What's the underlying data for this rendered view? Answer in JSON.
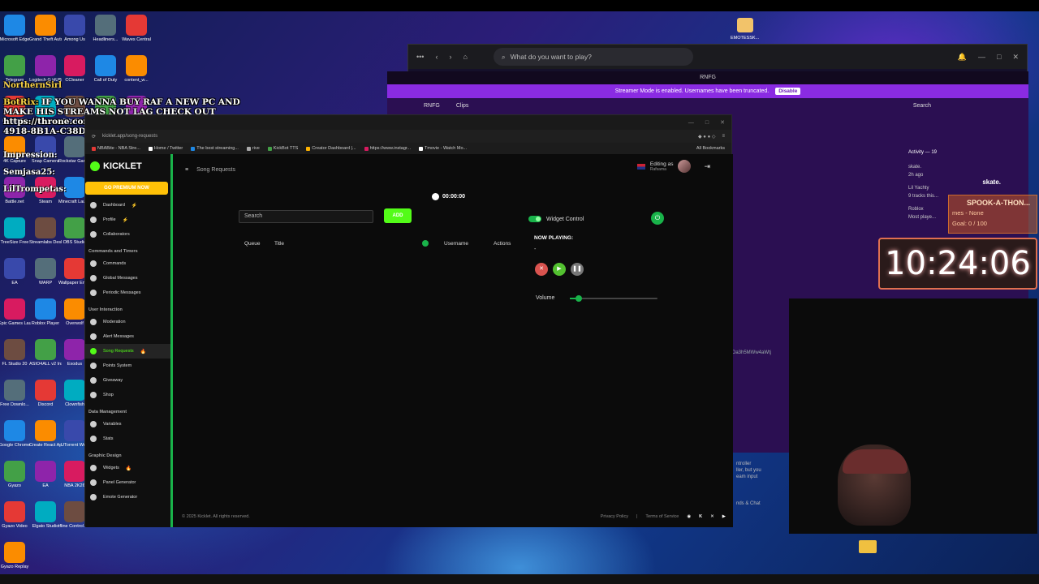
{
  "overlay": {
    "message_user": "BotRix:",
    "message": "IF YOU WANNA BUY RAF A NEW PC AND MAKE HIS STREAMS NOT LAG CHECK OUT https://throne.com/rafsama/item/E0E75993-23DF-4918-8B1A-C38D67313457",
    "northern": "NorthernSirl",
    "impression": "Impression:",
    "semjasa": "Semjasa25:",
    "trompetas": "LilTrompetas:"
  },
  "desktop_icons": {
    "col1": [
      "Microsoft Edge",
      "Telegram",
      "NorthernSirl",
      "4K Capture",
      "Battle.net",
      "TreeSize Free",
      "EA",
      "Epic Games Launcher",
      "FL Studio 20",
      "Free Downlo...",
      "Google Chrome",
      "Gyazo",
      "Gyazo Video",
      "Gyazo Replay"
    ],
    "col2": [
      "Grand Theft Auto V",
      "Logitech G HUB",
      "",
      "Snap Camera",
      "Steam",
      "Streamlabs Desktop",
      "WARP",
      "Roblox Player",
      "ASIO4ALL v2 Instruction...",
      "Discord",
      "Create React App Sample",
      "EA",
      "Elgato Studio"
    ],
    "col3": [
      "Among Us",
      "CCleaner",
      "Baby Steps",
      "Rockstar Games",
      "Minecraft Launcher",
      "OBS Studio",
      "Wallpaper Engine",
      "Overwolf",
      "Exodus",
      "Clownfish",
      "UTorrent Web",
      "NBA 2K26",
      "tfline Control Deck.exe"
    ],
    "col4": [
      "Headliners...",
      "Call of Duty",
      "NVIDIA App",
      "skate.",
      ""
    ],
    "col5": [
      "Waves Central",
      "content_w...",
      "content_w...",
      "content_wa..."
    ],
    "emotes": "EMOTESSK..."
  },
  "bg_browser": {
    "search_placeholder": "What do you want to play?",
    "discord_title": "RNFG",
    "streamer_mode": "Streamer Mode is enabled. Usernames have been truncated.",
    "disable_label": "Disable",
    "server_name": "RNFG",
    "channel_name": "Clips",
    "search_label": "Search",
    "activity_title": "Activity — 19",
    "activity_items": [
      "skate.",
      "2h ago",
      "Lil Yachty",
      "9 tracks this...",
      "Roblox",
      "Most playe..."
    ],
    "skate_label": "skate.",
    "hash_text": "tOa3h5MWw4aWtj",
    "controller_text": "ntroller\nller, but you\neam input",
    "friends_chat": "nds & Chat"
  },
  "browser": {
    "url": "kicklet.app/song-requests",
    "bookmarks": [
      "NBABite - NBA Stre...",
      "Home / Twitter",
      "The best streaming...",
      "rive",
      "KickBot TTS",
      "Creator Dashboard |...",
      "https://www.instagr...",
      "Tmovie - Watch Mo..."
    ],
    "all_bookmarks": "All Bookmarks"
  },
  "app": {
    "logo_text": "KICKLET",
    "premium_label": "GO PREMIUM NOW",
    "page_title": "Song Requests",
    "editing_as": "Editing as",
    "editing_user": "Rafsama",
    "nav_top": [
      {
        "label": "Dashboard",
        "badge": "⚡"
      },
      {
        "label": "Profile",
        "badge": "⚡"
      },
      {
        "label": "Collaborators",
        "badge": ""
      }
    ],
    "sec_commands": "Commands and Timers",
    "nav_commands": [
      {
        "label": "Commands",
        "badge": ""
      },
      {
        "label": "Global Messages",
        "badge": ""
      },
      {
        "label": "Periodic Messages",
        "badge": ""
      }
    ],
    "sec_user": "User Interaction",
    "nav_user": [
      {
        "label": "Moderation",
        "badge": ""
      },
      {
        "label": "Alert Messages",
        "badge": ""
      },
      {
        "label": "Song Requests",
        "badge": "🔥"
      },
      {
        "label": "Points System",
        "badge": ""
      },
      {
        "label": "Giveaway",
        "badge": ""
      },
      {
        "label": "Shop",
        "badge": ""
      }
    ],
    "sec_data": "Data Management",
    "nav_data": [
      {
        "label": "Variables",
        "badge": ""
      },
      {
        "label": "Stats",
        "badge": ""
      }
    ],
    "sec_graphic": "Graphic Design",
    "nav_graphic": [
      {
        "label": "Widgets",
        "badge": "🔥"
      },
      {
        "label": "Panel Generator",
        "badge": ""
      },
      {
        "label": "Emote Generator",
        "badge": ""
      }
    ],
    "timer": "00:00:00",
    "search_placeholder": "Search",
    "add_label": "ADD",
    "col_queue": "Queue",
    "col_title": "Title",
    "col_username": "Username",
    "col_actions": "Actions",
    "widget_control": "Widget Control",
    "now_playing": "NOW PLAYING:",
    "now_playing_track": "-",
    "volume_label": "Volume",
    "volume_level": 0.1,
    "copyright": "© 2025 Kicklet. All rights reserved.",
    "privacy": "Privacy Policy",
    "separator": "|",
    "terms": "Terms of Service"
  },
  "stream": {
    "spook_title": "SPOOK-A-THON...",
    "spook_line1": "mes - None",
    "spook_goal": "Goal: 0 / 100",
    "clock": "10:24:06"
  },
  "colors": {
    "kick_green": "#53fc18",
    "premium_yellow": "#ffc107",
    "discord_purple": "#8a2be2"
  }
}
